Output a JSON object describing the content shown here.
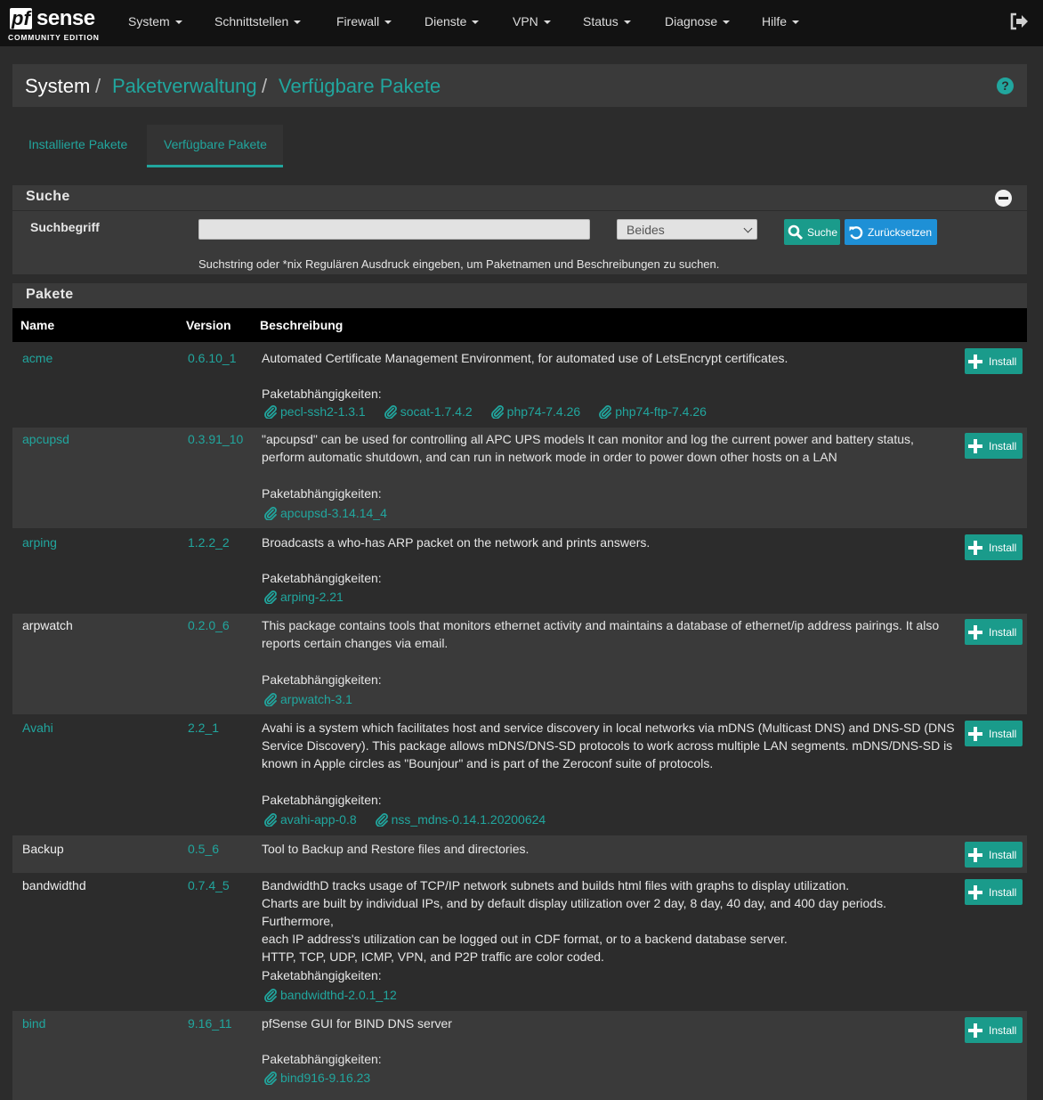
{
  "brand": {
    "pf": "pf",
    "sense": "sense",
    "edition": "COMMUNITY EDITION"
  },
  "nav": [
    "System",
    "Schnittstellen",
    "Firewall",
    "Dienste",
    "VPN",
    "Status",
    "Diagnose",
    "Hilfe"
  ],
  "breadcrumb": {
    "root": "System",
    "sep": "/",
    "level1": "Paketverwaltung",
    "level2": "Verfügbare Pakete"
  },
  "tabs": {
    "installed": "Installierte Pakete",
    "available": "Verfügbare Pakete"
  },
  "search": {
    "title": "Suche",
    "label": "Suchbegriff",
    "value": "",
    "select_value": "Beides",
    "search_button": "Suche",
    "reset_button": "Zurücksetzen",
    "help": "Suchstring oder *nix Regulären Ausdruck eingeben, um Paketnamen und Beschreibungen zu suchen."
  },
  "packages_panel": {
    "title": "Pakete",
    "columns": {
      "name": "Name",
      "version": "Version",
      "description": "Beschreibung"
    },
    "dependencies_label": "Paketabhängigkeiten:",
    "install_label": "Install",
    "rows": [
      {
        "name": "acme",
        "version": "0.6.10_1",
        "desc": [
          "Automated Certificate Management Environment, for automated use of LetsEncrypt certificates."
        ],
        "deps": [
          "pecl-ssh2-1.3.1",
          "socat-1.7.4.2",
          "php74-7.4.26",
          "php74-ftp-7.4.26"
        ]
      },
      {
        "name": "apcupsd",
        "version": "0.3.91_10",
        "desc": [
          "\"apcupsd\" can be used for controlling all APC UPS models It can monitor and log the current power and battery status,",
          "perform automatic shutdown, and can run in network mode in order to power down other hosts on a LAN"
        ],
        "deps": [
          "apcupsd-3.14.14_4"
        ]
      },
      {
        "name": "arping",
        "version": "1.2.2_2",
        "desc": [
          "Broadcasts a who-has ARP packet on the network and prints answers."
        ],
        "deps": [
          "arping-2.21"
        ]
      },
      {
        "name": "arpwatch",
        "version": "0.2.0_6",
        "desc": [
          "This package contains tools that monitors ethernet activity and maintains a database of ethernet/ip address pairings. It also",
          "reports certain changes via email."
        ],
        "deps": [
          "arpwatch-3.1"
        ]
      },
      {
        "name": "Avahi",
        "version": "2.2_1",
        "desc": [
          "Avahi is a system which facilitates host and service discovery in local networks via mDNS (Multicast DNS) and DNS-SD (DNS",
          "Service Discovery). This package allows mDNS/DNS-SD protocols to work across multiple LAN segments. mDNS/DNS-SD is",
          "known in Apple circles as \"Bounjour\" and is part of the Zeroconf suite of protocols."
        ],
        "deps": [
          "avahi-app-0.8",
          "nss_mdns-0.14.1.20200624"
        ]
      },
      {
        "name": "Backup",
        "version": "0.5_6",
        "desc": [
          "Tool to Backup and Restore files and directories."
        ],
        "deps": []
      },
      {
        "name": "bandwidthd",
        "version": "0.7.4_5",
        "desc": [
          "BandwidthD tracks usage of TCP/IP network subnets and builds html files with graphs to display utilization.",
          "Charts are built by individual IPs, and by default display utilization over 2 day, 8 day, 40 day, and 400 day periods. Furthermore,",
          "each IP address's utilization can be logged out in CDF format, or to a backend database server.",
          "HTTP, TCP, UDP, ICMP, VPN, and P2P traffic are color coded."
        ],
        "deps": [
          "bandwidthd-2.0.1_12"
        ]
      },
      {
        "name": "bind",
        "version": "9.16_11",
        "desc": [
          "pfSense GUI for BIND DNS server"
        ],
        "deps": [
          "bind916-9.16.23"
        ]
      }
    ]
  }
}
